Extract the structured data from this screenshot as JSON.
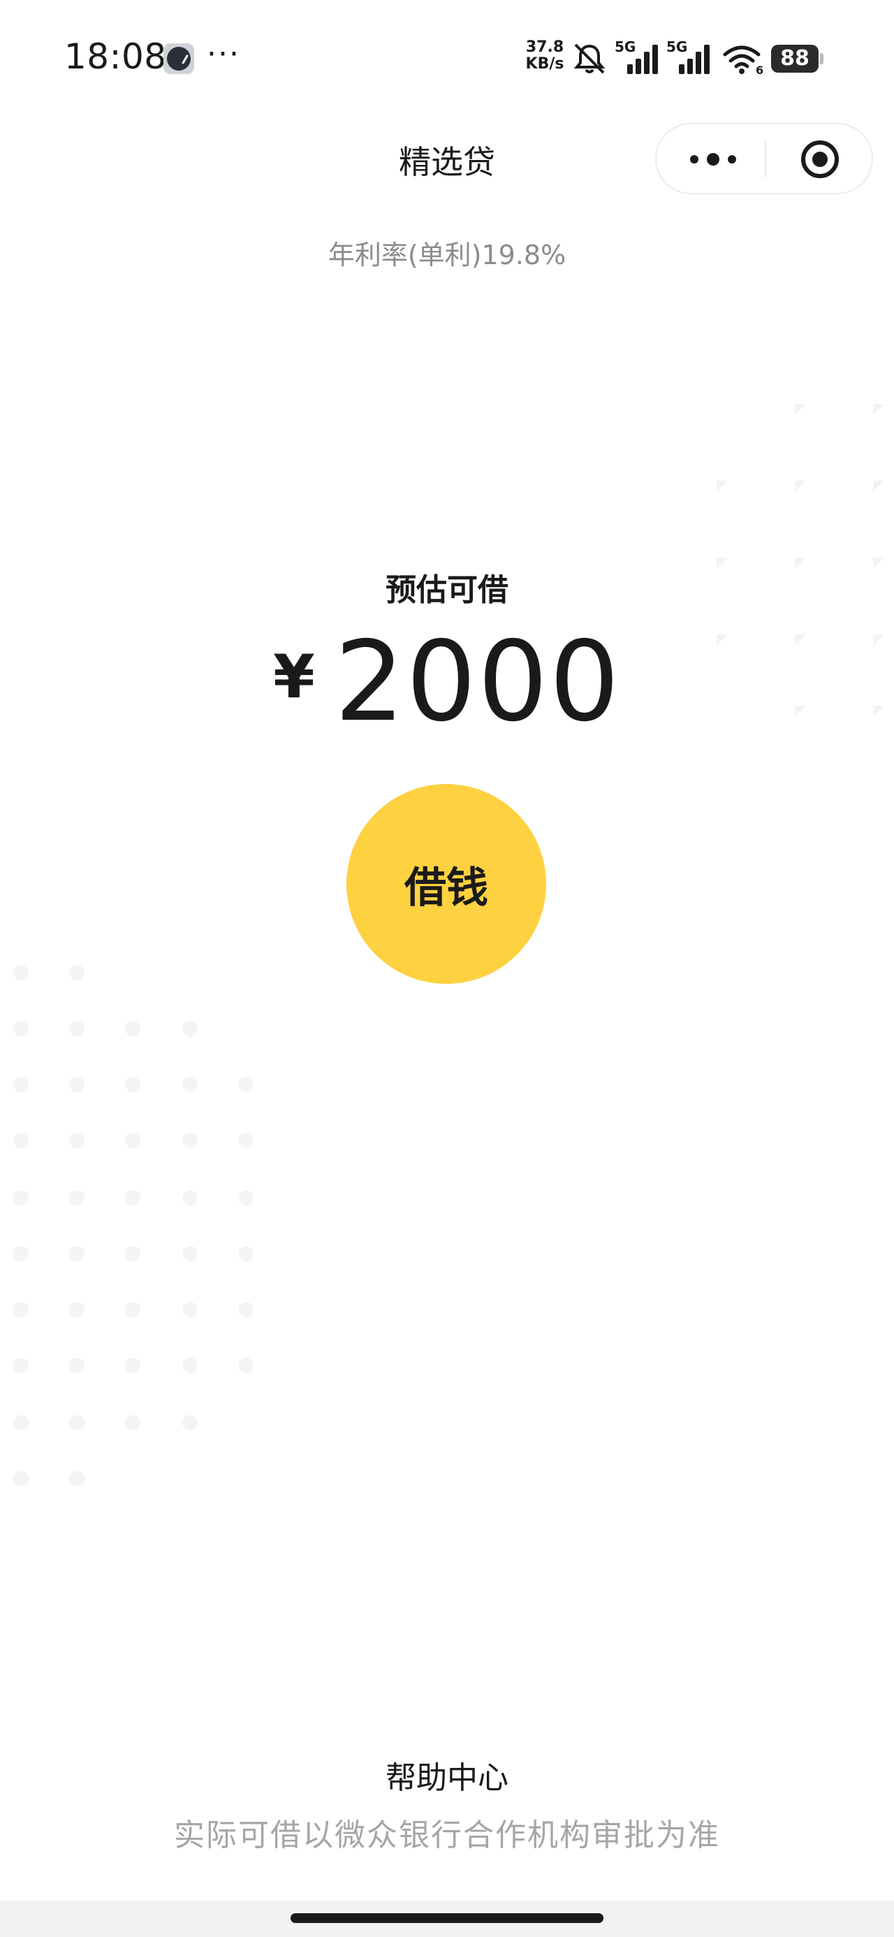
{
  "status_bar": {
    "time": "18:08",
    "more": "···",
    "net_speed_value": "37.8",
    "net_speed_unit": "KB/s",
    "signal_1_label": "5G",
    "signal_2_label": "5G",
    "wifi_label": "6",
    "battery": "88",
    "icons": [
      "clock-app-icon",
      "mute-icon",
      "signal-icon",
      "signal-icon",
      "wifi-icon",
      "battery-icon"
    ]
  },
  "header": {
    "title": "精选贷",
    "capsule_icons": [
      "more-dots-icon",
      "close-miniprogram-icon"
    ]
  },
  "rate": "年利率(单利)19.8%",
  "loan": {
    "estimate_label": "预估可借",
    "currency": "¥",
    "amount": "2000",
    "button_label": "借钱"
  },
  "footer": {
    "help_center": "帮助中心",
    "disclaimer": "实际可借以微众银行合作机构审批为准"
  },
  "colors": {
    "accent": "#fed141",
    "text": "#1a1a1a",
    "muted": "#8c8c8c",
    "disclaimer": "#a6a6a6"
  }
}
